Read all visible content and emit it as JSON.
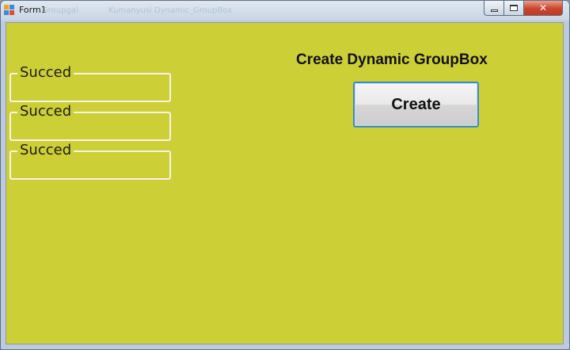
{
  "window": {
    "title": "Form1",
    "background_title_fragments": [
      "Groupgal",
      "Kumanyusi Dynamic_GroupBox"
    ],
    "caption_buttons": {
      "close_label": "✕"
    }
  },
  "form": {
    "background_color": "#cdcf36",
    "heading": "Create Dynamic GroupBox",
    "create_button_label": "Create",
    "groupboxes": [
      {
        "label": "Succed"
      },
      {
        "label": "Succed"
      },
      {
        "label": "Succed"
      }
    ]
  },
  "colors": {
    "client_background": "#cdcf36",
    "groupbox_border": "#f4f5e6",
    "button_focus_border": "#3d8bc4",
    "close_button": "#c9442c"
  }
}
